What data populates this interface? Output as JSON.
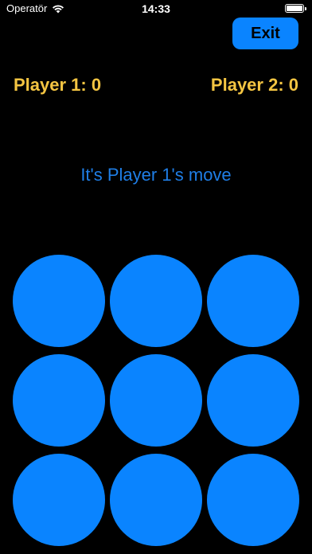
{
  "status_bar": {
    "carrier": "Operatör",
    "time": "14:33",
    "battery_level": 1.0
  },
  "exit_button": {
    "label": "Exit"
  },
  "scores": {
    "player1": "Player 1: 0",
    "player2": "Player 2: 0"
  },
  "turn_text": "It's Player 1's move",
  "board": {
    "cells": [
      "",
      "",
      "",
      "",
      "",
      "",
      "",
      "",
      ""
    ]
  },
  "colors": {
    "background": "#000000",
    "accent": "#0a84ff",
    "score_text": "#f4c542",
    "turn_text": "#1f7ee6"
  }
}
